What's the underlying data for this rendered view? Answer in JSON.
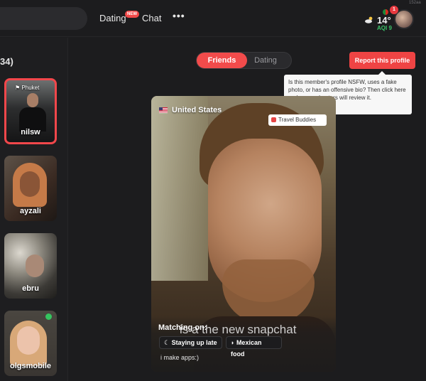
{
  "header": {
    "nav": {
      "dating_label": "Dating",
      "new_badge": "NEW",
      "chat_label": "Chat",
      "more_label": "•••"
    },
    "weather": {
      "temperature": "14°",
      "aqi": "AQI 9",
      "icon": "cloud-sun-icon"
    },
    "notifications_count": "1",
    "corner_code": "152aa"
  },
  "sidebar": {
    "heading": "34)",
    "profiles": [
      {
        "name": "nilsw",
        "location": "Phuket",
        "selected": true
      },
      {
        "name": "ayzali"
      },
      {
        "name": "ebru"
      },
      {
        "name": "olgsmobile",
        "online": true
      }
    ]
  },
  "mode_toggle": {
    "friends_label": "Friends",
    "dating_label": "Dating",
    "active": "Friends"
  },
  "report": {
    "button_label": "Report this profile",
    "tooltip": "Is this member's profile NSFW, uses a fake photo, or has an offensive bio? Then click here and our moderators will review it."
  },
  "profile_card": {
    "country": "United States",
    "badge": "Travel Buddies",
    "photo_caption": "is a the new snapchat",
    "matching_label": "Matching on:",
    "tags": [
      "Staying up late",
      "Mexican food"
    ],
    "tag_icons": [
      "moon-icon",
      "taco-icon"
    ],
    "bio": "i make apps:)"
  },
  "colors": {
    "accent": "#f24b4b",
    "online": "#35c45f",
    "aqi_good": "#3bc46a",
    "background": "#1c1c1e"
  }
}
